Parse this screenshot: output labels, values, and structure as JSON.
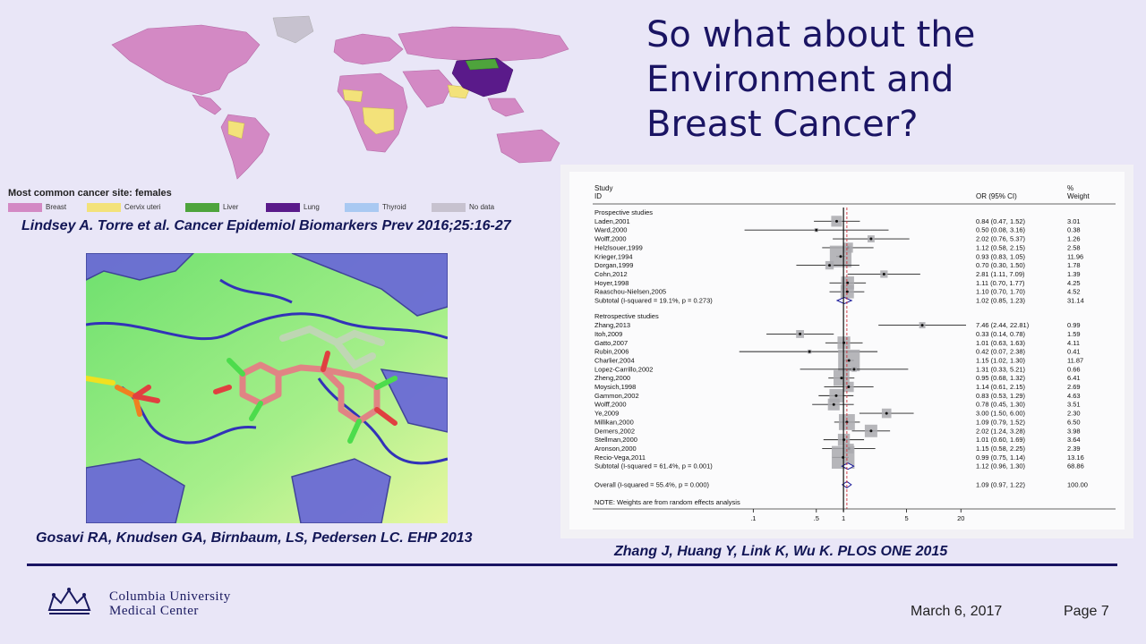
{
  "slide": {
    "title_lines": [
      "So what about the",
      "Environment and",
      "Breast Cancer?"
    ],
    "date": "March 6, 2017",
    "page": "Page 7"
  },
  "map": {
    "legend_title": "Most common cancer site: females",
    "legend": [
      {
        "label": "Breast",
        "color": "#d389c4"
      },
      {
        "label": "Cervix uteri",
        "color": "#f3e27a"
      },
      {
        "label": "Liver",
        "color": "#4ea43c"
      },
      {
        "label": "Lung",
        "color": "#5a1a8a"
      },
      {
        "label": "Thyroid",
        "color": "#a9c9f2"
      },
      {
        "label": "No data",
        "color": "#c7c2cf"
      }
    ]
  },
  "citations": {
    "torre": "Lindsey A. Torre et al. Cancer Epidemiol Biomarkers Prev 2016;25:16-27",
    "gosavi": "Gosavi RA, Knudsen GA, Birnbaum, LS, Pedersen LC. EHP 2013",
    "zhang": "Zhang J, Huang Y, Link K, Wu K. PLOS ONE 2015"
  },
  "institution": {
    "line1": "Columbia University",
    "line2": "Medical Center"
  },
  "forest_headers": {
    "study": "Study",
    "id": "ID",
    "or": "OR (95% CI)",
    "pct": "%",
    "weight": "Weight",
    "note": "NOTE: Weights are from random effects analysis"
  },
  "chart_data": {
    "type": "scatter",
    "title": "",
    "xlabel": "",
    "ylabel": "",
    "x_scale": "log",
    "x_ticks": [
      0.1,
      0.5,
      1,
      5,
      20
    ],
    "x_tick_labels": [
      ".1",
      ".5",
      "1",
      "5",
      "20"
    ],
    "groups": [
      {
        "name": "Prospective studies",
        "studies": [
          {
            "id": "Laden,2001",
            "or": 0.84,
            "lo": 0.47,
            "hi": 1.52,
            "ci_text": "0.84 (0.47, 1.52)",
            "weight": "3.01"
          },
          {
            "id": "Ward,2000",
            "or": 0.5,
            "lo": 0.08,
            "hi": 3.16,
            "ci_text": "0.50 (0.08, 3.16)",
            "weight": "0.38"
          },
          {
            "id": "Wolff,2000",
            "or": 2.02,
            "lo": 0.76,
            "hi": 5.37,
            "ci_text": "2.02 (0.76, 5.37)",
            "weight": "1.26"
          },
          {
            "id": "Helzlsouer,1999",
            "or": 1.12,
            "lo": 0.58,
            "hi": 2.15,
            "ci_text": "1.12 (0.58, 2.15)",
            "weight": "2.58"
          },
          {
            "id": "Krieger,1994",
            "or": 0.93,
            "lo": 0.83,
            "hi": 1.05,
            "ci_text": "0.93 (0.83, 1.05)",
            "weight": "11.96"
          },
          {
            "id": "Dorgan,1999",
            "or": 0.7,
            "lo": 0.3,
            "hi": 1.5,
            "ci_text": "0.70 (0.30, 1.50)",
            "weight": "1.78"
          },
          {
            "id": "Cohn,2012",
            "or": 2.81,
            "lo": 1.11,
            "hi": 7.09,
            "ci_text": "2.81 (1.11, 7.09)",
            "weight": "1.39"
          },
          {
            "id": "Hoyer,1998",
            "or": 1.11,
            "lo": 0.7,
            "hi": 1.77,
            "ci_text": "1.11 (0.70, 1.77)",
            "weight": "4.25"
          },
          {
            "id": "Raaschou-Nielsen,2005",
            "or": 1.1,
            "lo": 0.7,
            "hi": 1.7,
            "ci_text": "1.10 (0.70, 1.70)",
            "weight": "4.52"
          }
        ],
        "subtotal": {
          "label": "Subtotal  (I-squared = 19.1%, p = 0.273)",
          "or": 1.02,
          "lo": 0.85,
          "hi": 1.23,
          "ci_text": "1.02 (0.85, 1.23)",
          "weight": "31.14"
        }
      },
      {
        "name": "Retrospective studies",
        "studies": [
          {
            "id": "Zhang,2013",
            "or": 7.46,
            "lo": 2.44,
            "hi": 22.81,
            "ci_text": "7.46 (2.44, 22.81)",
            "weight": "0.99"
          },
          {
            "id": "Itoh,2009",
            "or": 0.33,
            "lo": 0.14,
            "hi": 0.78,
            "ci_text": "0.33 (0.14, 0.78)",
            "weight": "1.59"
          },
          {
            "id": "Gatto,2007",
            "or": 1.01,
            "lo": 0.63,
            "hi": 1.63,
            "ci_text": "1.01 (0.63, 1.63)",
            "weight": "4.11"
          },
          {
            "id": "Rubin,2006",
            "or": 0.42,
            "lo": 0.07,
            "hi": 2.38,
            "ci_text": "0.42 (0.07, 2.38)",
            "weight": "0.41"
          },
          {
            "id": "Charlier,2004",
            "or": 1.15,
            "lo": 1.02,
            "hi": 1.3,
            "ci_text": "1.15 (1.02, 1.30)",
            "weight": "11.87"
          },
          {
            "id": "Lopez-Carrillo,2002",
            "or": 1.31,
            "lo": 0.33,
            "hi": 5.21,
            "ci_text": "1.31 (0.33, 5.21)",
            "weight": "0.66"
          },
          {
            "id": "Zheng,2000",
            "or": 0.95,
            "lo": 0.68,
            "hi": 1.32,
            "ci_text": "0.95 (0.68, 1.32)",
            "weight": "6.41"
          },
          {
            "id": "Moysich,1998",
            "or": 1.14,
            "lo": 0.61,
            "hi": 2.15,
            "ci_text": "1.14 (0.61, 2.15)",
            "weight": "2.69"
          },
          {
            "id": "Gammon,2002",
            "or": 0.83,
            "lo": 0.53,
            "hi": 1.29,
            "ci_text": "0.83 (0.53, 1.29)",
            "weight": "4.63"
          },
          {
            "id": "Wolff,2000",
            "or": 0.78,
            "lo": 0.45,
            "hi": 1.3,
            "ci_text": "0.78 (0.45, 1.30)",
            "weight": "3.51"
          },
          {
            "id": "Ye,2009",
            "or": 3.0,
            "lo": 1.5,
            "hi": 6.0,
            "ci_text": "3.00 (1.50, 6.00)",
            "weight": "2.30"
          },
          {
            "id": "Millikan,2000",
            "or": 1.09,
            "lo": 0.79,
            "hi": 1.52,
            "ci_text": "1.09 (0.79, 1.52)",
            "weight": "6.50"
          },
          {
            "id": "Demers,2002",
            "or": 2.02,
            "lo": 1.24,
            "hi": 3.28,
            "ci_text": "2.02 (1.24, 3.28)",
            "weight": "3.98"
          },
          {
            "id": "Stellman,2000",
            "or": 1.01,
            "lo": 0.6,
            "hi": 1.69,
            "ci_text": "1.01 (0.60, 1.69)",
            "weight": "3.64"
          },
          {
            "id": "Aronson,2000",
            "or": 1.15,
            "lo": 0.58,
            "hi": 2.25,
            "ci_text": "1.15 (0.58, 2.25)",
            "weight": "2.39"
          },
          {
            "id": "Recio-Vega,2011",
            "or": 0.99,
            "lo": 0.75,
            "hi": 1.14,
            "ci_text": "0.99 (0.75, 1.14)",
            "weight": "13.16"
          }
        ],
        "subtotal": {
          "label": "Subtotal  (I-squared = 61.4%, p = 0.001)",
          "or": 1.12,
          "lo": 0.96,
          "hi": 1.3,
          "ci_text": "1.12 (0.96, 1.30)",
          "weight": "68.86"
        }
      }
    ],
    "overall": {
      "label": "Overall  (I-squared = 55.4%, p = 0.000)",
      "or": 1.09,
      "lo": 0.97,
      "hi": 1.22,
      "ci_text": "1.09 (0.97, 1.22)",
      "weight": "100.00"
    }
  }
}
